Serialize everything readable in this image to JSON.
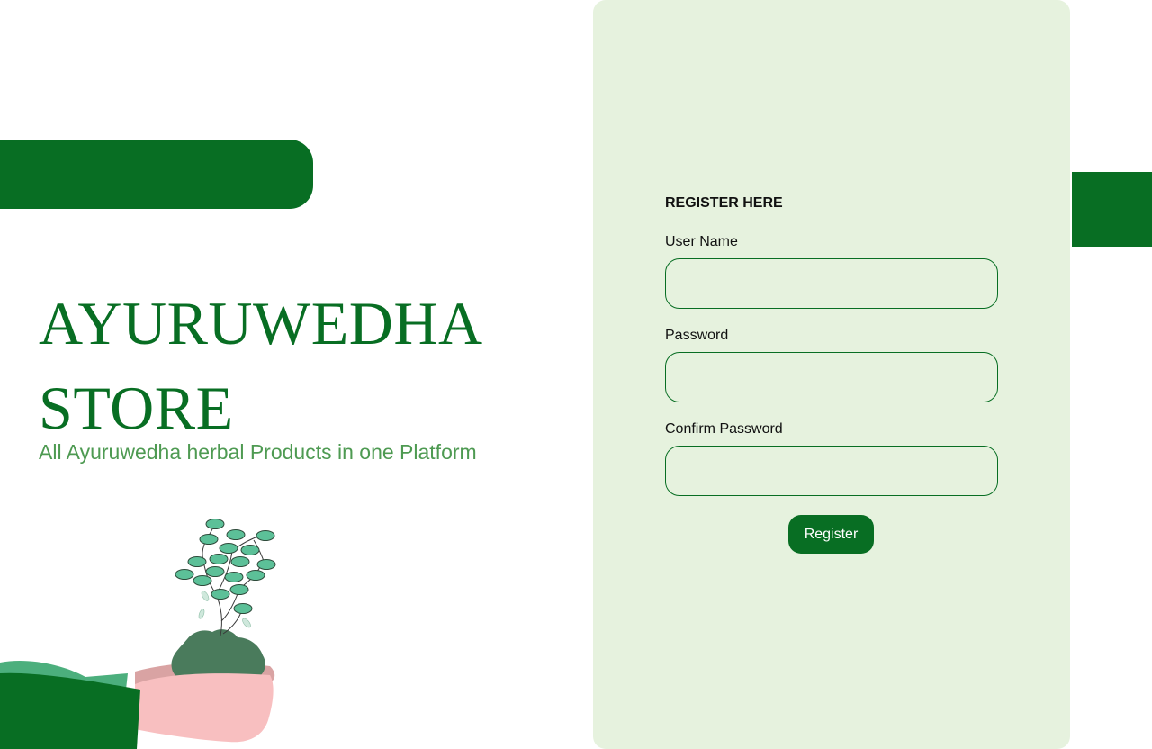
{
  "brand": {
    "title_line1": "AYURUWEDHA",
    "title_line2": "STORE",
    "tagline": "All Ayuruwedha herbal Products in one Platform"
  },
  "form": {
    "heading": "REGISTER HERE",
    "fields": [
      {
        "label": "User Name",
        "value": "",
        "placeholder": ""
      },
      {
        "label": "Password",
        "value": "",
        "placeholder": ""
      },
      {
        "label": "Confirm Password",
        "value": "",
        "placeholder": ""
      }
    ],
    "submit_label": "Register"
  },
  "colors": {
    "primary_green": "#086e23",
    "panel_bg": "#e6f2de",
    "tagline_green": "#4e9a52"
  },
  "icons": {
    "illustration": "hands-holding-plant-icon"
  }
}
